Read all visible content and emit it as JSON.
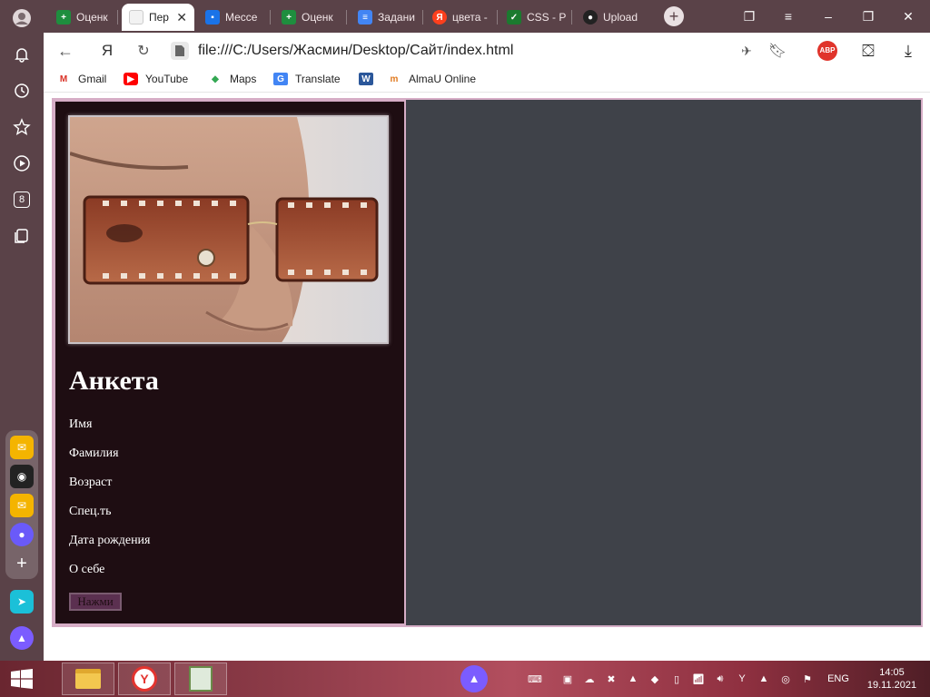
{
  "browser": {
    "tabs": [
      {
        "label": "Оценк",
        "favicon": "sheets-icon",
        "color": "#1e8e3e"
      },
      {
        "label": "Пер",
        "favicon": "page-icon",
        "color": "#cccccc",
        "active": true
      },
      {
        "label": "Мессе",
        "favicon": "messenger-icon",
        "color": "#1a73e8"
      },
      {
        "label": "Оценк",
        "favicon": "sheets-icon",
        "color": "#1e8e3e"
      },
      {
        "label": "Задани",
        "favicon": "docs-icon",
        "color": "#4285f4"
      },
      {
        "label": "цвета -",
        "favicon": "yandex-icon",
        "color": "#fc3f1d"
      },
      {
        "label": "CSS - P",
        "favicon": "css-icon",
        "color": "#1b7a2f"
      },
      {
        "label": "Upload",
        "favicon": "github-icon",
        "color": "#222222"
      }
    ],
    "yandex_letter": "Я",
    "url": "file:///C:/Users/Жасмин/Desktop/Сайт/index.html",
    "abp_label": "ABP",
    "sidebar_badge": "8",
    "bookmarks": [
      {
        "label": "Gmail",
        "icon": "gmail-icon"
      },
      {
        "label": "YouTube",
        "icon": "youtube-icon"
      },
      {
        "label": "Maps",
        "icon": "maps-icon"
      },
      {
        "label": "Translate",
        "icon": "translate-icon"
      },
      {
        "label": "",
        "icon": "word-icon"
      },
      {
        "label": "AlmaU Online",
        "icon": "almau-icon"
      }
    ]
  },
  "page": {
    "title": "Анкета",
    "fields": [
      "Имя",
      "Фамилия",
      "Возраст",
      "Спец.ть",
      "Дата рождения",
      "О себе"
    ],
    "button_label": "Нажми",
    "colors": {
      "card_bg": "#1e0d12",
      "frame_border": "#d6adc6",
      "page_bg": "#3f4249",
      "button_bg": "#5b3050"
    }
  },
  "taskbar": {
    "language": "ENG",
    "time": "14:05",
    "date": "19.11.2021"
  }
}
